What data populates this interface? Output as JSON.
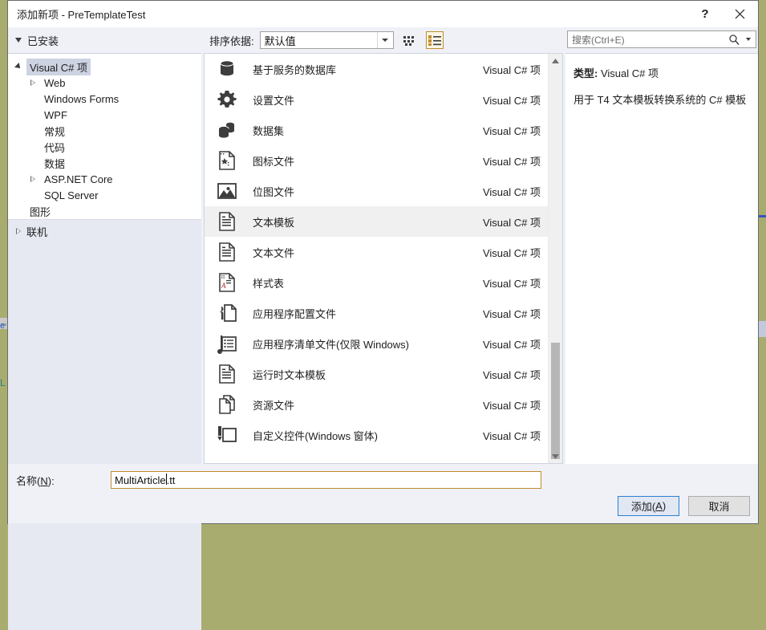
{
  "window": {
    "title": "添加新项 - PreTemplateTest",
    "help_label": "?",
    "close_label": "✕"
  },
  "toolbar": {
    "installed_label": "已安装",
    "sortby_label": "排序依据:",
    "sort_value": "默认值",
    "view_grid_icon": "grid-view-icon",
    "view_list_icon": "list-view-icon"
  },
  "search": {
    "placeholder": "搜索(Ctrl+E)",
    "icon": "search-icon"
  },
  "tree": {
    "nodes": [
      {
        "label": "Visual C# 项",
        "depth": 1,
        "expander": "open",
        "selected": true
      },
      {
        "label": "Web",
        "depth": 2,
        "expander": "closed",
        "selected": false
      },
      {
        "label": "Windows Forms",
        "depth": 2,
        "expander": "none",
        "selected": false
      },
      {
        "label": "WPF",
        "depth": 2,
        "expander": "none",
        "selected": false
      },
      {
        "label": "常规",
        "depth": 2,
        "expander": "none",
        "selected": false
      },
      {
        "label": "代码",
        "depth": 2,
        "expander": "none",
        "selected": false
      },
      {
        "label": "数据",
        "depth": 2,
        "expander": "none",
        "selected": false
      },
      {
        "label": "ASP.NET Core",
        "depth": 2,
        "expander": "closed",
        "selected": false
      },
      {
        "label": "SQL Server",
        "depth": 2,
        "expander": "none",
        "selected": false
      },
      {
        "label": "图形",
        "depth": 1,
        "expander": "none",
        "selected": false
      }
    ],
    "online_label": "联机"
  },
  "list": {
    "items": [
      {
        "name": "基于服务的数据库",
        "kind": "Visual C# 项",
        "icon": "database-icon",
        "selected": false
      },
      {
        "name": "设置文件",
        "kind": "Visual C# 项",
        "icon": "gear-icon",
        "selected": false
      },
      {
        "name": "数据集",
        "kind": "Visual C# 项",
        "icon": "dataset-icon",
        "selected": false
      },
      {
        "name": "图标文件",
        "kind": "Visual C# 项",
        "icon": "icon-file-icon",
        "selected": false
      },
      {
        "name": "位图文件",
        "kind": "Visual C# 项",
        "icon": "bitmap-file-icon",
        "selected": false
      },
      {
        "name": "文本模板",
        "kind": "Visual C# 项",
        "icon": "text-template-icon",
        "selected": true
      },
      {
        "name": "文本文件",
        "kind": "Visual C# 项",
        "icon": "text-file-icon",
        "selected": false
      },
      {
        "name": "样式表",
        "kind": "Visual C# 项",
        "icon": "stylesheet-icon",
        "selected": false
      },
      {
        "name": "应用程序配置文件",
        "kind": "Visual C# 项",
        "icon": "app-config-icon",
        "selected": false
      },
      {
        "name": "应用程序清单文件(仅限 Windows)",
        "kind": "Visual C# 项",
        "icon": "app-manifest-icon",
        "selected": false
      },
      {
        "name": "运行时文本模板",
        "kind": "Visual C# 项",
        "icon": "runtime-text-template-icon",
        "selected": false
      },
      {
        "name": "资源文件",
        "kind": "Visual C# 项",
        "icon": "resource-file-icon",
        "selected": false
      },
      {
        "name": "自定义控件(Windows 窗体)",
        "kind": "Visual C# 项",
        "icon": "custom-control-icon",
        "selected": false
      }
    ]
  },
  "details": {
    "type_label": "类型:",
    "type_value": "Visual C# 项",
    "description": "用于 T4 文本模板转换系统的 C# 模板"
  },
  "footer": {
    "name_label_prefix": "名称(",
    "name_label_key": "N",
    "name_label_suffix": "):",
    "name_value_before_caret": "MultiArticle",
    "name_value_after_caret": ".tt",
    "add_button_prefix": "添加(",
    "add_button_key": "A",
    "add_button_suffix": ")",
    "cancel_button": "取消"
  },
  "colors": {
    "accent": "#2a7fd4",
    "focus_border": "#c08b2e",
    "selection": "#cdd3e2",
    "row_selection": "#f0f0f0",
    "dialog_bg": "#eff1f7",
    "backdrop": "#a8ad6f"
  }
}
